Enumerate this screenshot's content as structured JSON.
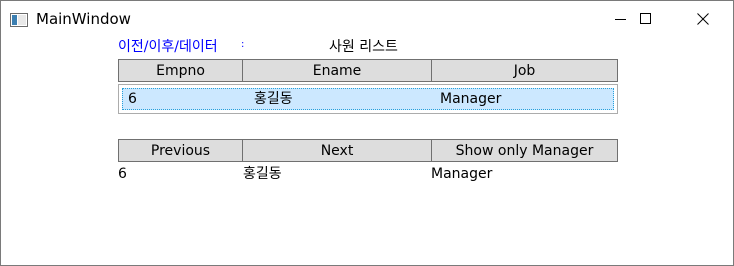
{
  "window": {
    "title": "MainWindow"
  },
  "header": {
    "nav_label": "이전/이후/데이터",
    "colon": ":",
    "list_title": "사원 리스트"
  },
  "columns": [
    "Empno",
    "Ename",
    "Job"
  ],
  "list": {
    "rows": [
      {
        "empno": "6",
        "ename": "홍길동",
        "job": "Manager"
      }
    ]
  },
  "buttons": {
    "previous": "Previous",
    "next": "Next",
    "show_manager": "Show only Manager"
  },
  "detail": {
    "empno": "6",
    "ename": "홍길동",
    "job": "Manager"
  },
  "icons": {
    "app": "window-app-icon",
    "minimize": "minimize-icon",
    "maximize": "maximize-icon",
    "close": "close-icon"
  },
  "colors": {
    "link_blue": "#0000ff",
    "selection": "#cce8ff",
    "selection_border": "#26a0da",
    "button_bg": "#dddddd"
  }
}
